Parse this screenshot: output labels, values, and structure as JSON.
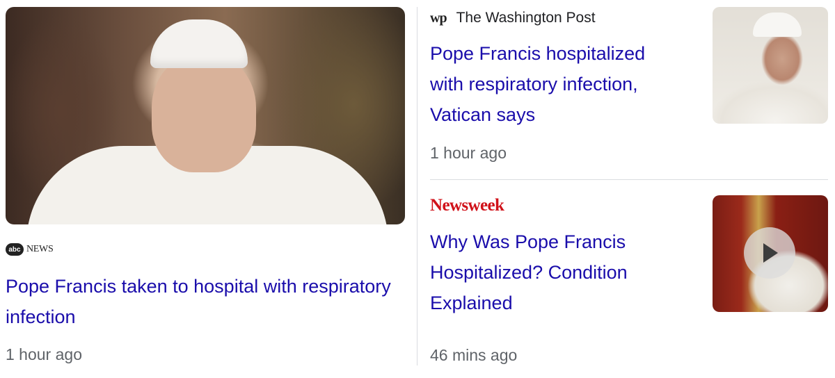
{
  "lead": {
    "source_logo": "abc",
    "source_name": "NEWS",
    "title": "Pope Francis taken to hospital with respiratory infection",
    "time": "1 hour ago"
  },
  "stories": [
    {
      "source_logo": "wp",
      "source_name": "The Washington Post",
      "title": "Pope Francis hospitalized with respiratory infection, Vatican says",
      "time": "1 hour ago"
    },
    {
      "source_logo": "Newsweek",
      "title": "Why Was Pope Francis Hospitalized? Condition Explained",
      "time": "46 mins ago",
      "thumbnail_icon": "play-icon"
    }
  ],
  "colors": {
    "link": "#1a0dab",
    "meta": "#5f6368",
    "newsweek_red": "#d0121a",
    "divider": "#dadce0"
  }
}
